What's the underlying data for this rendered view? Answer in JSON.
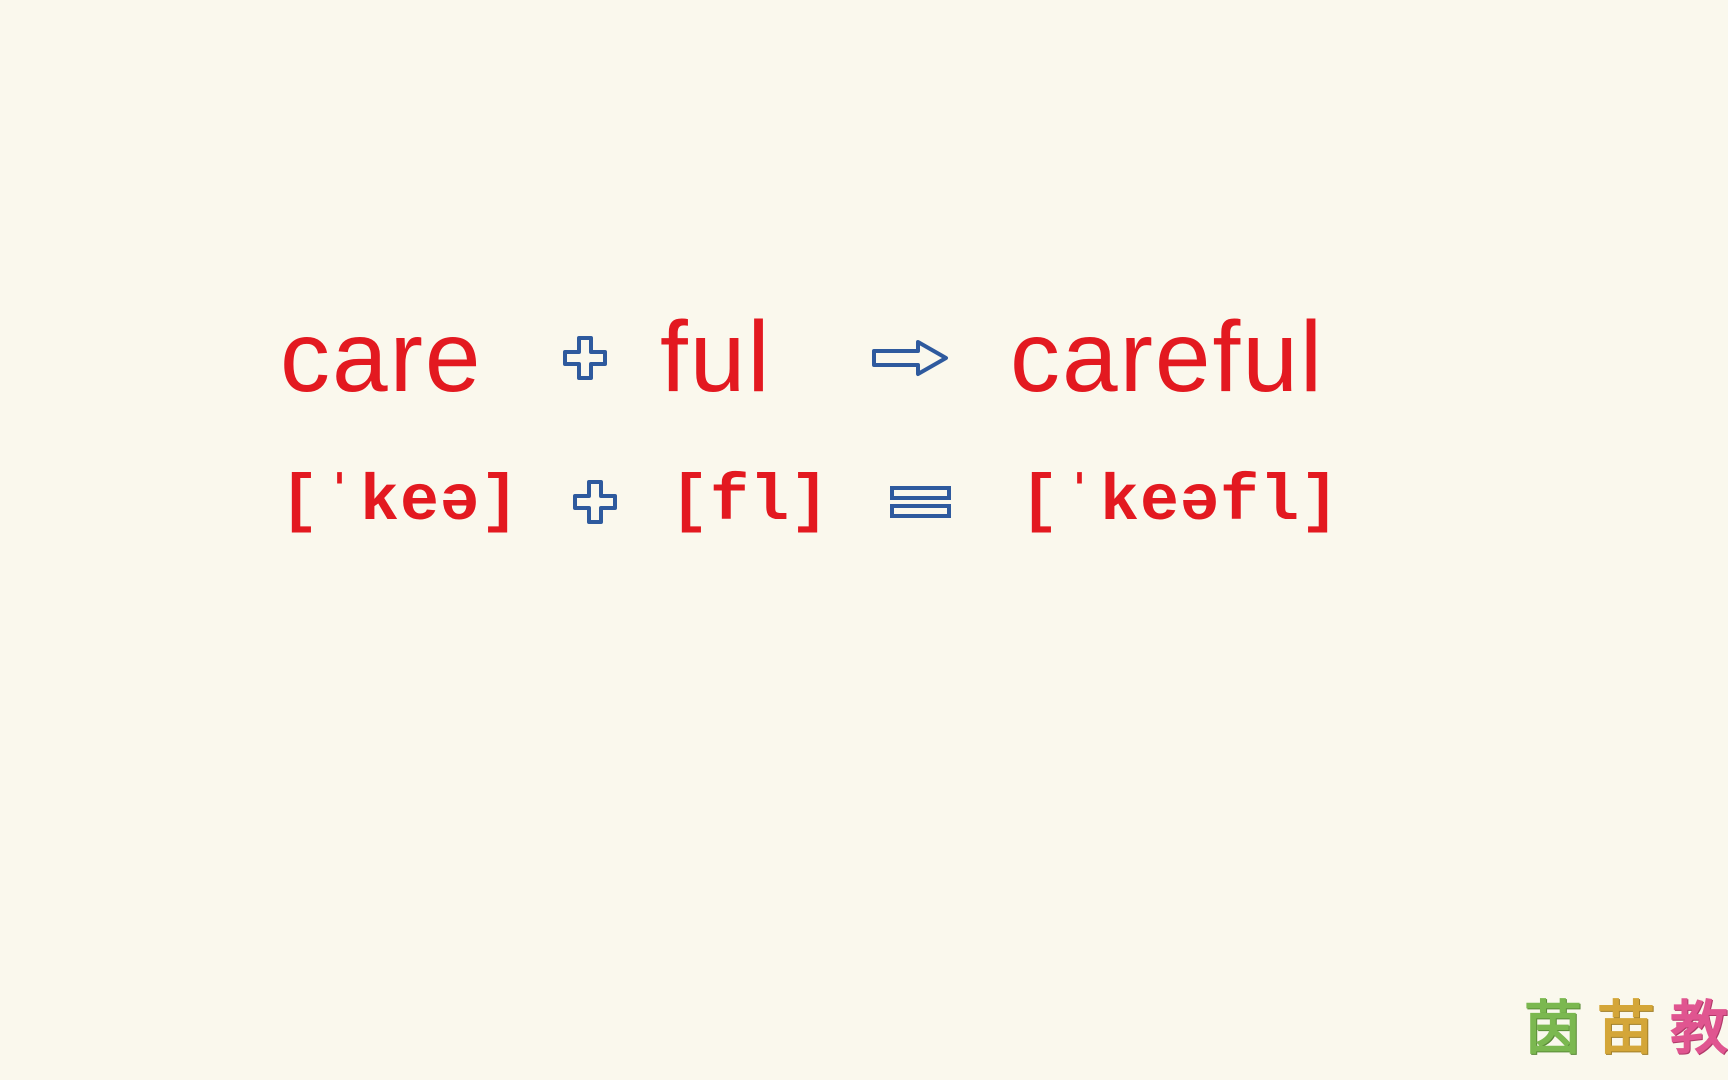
{
  "row1": {
    "part1": "care",
    "part2": "ful",
    "result": "careful"
  },
  "row2": {
    "part1": "[ˈkeə]",
    "part2": "[fl]",
    "result": "[ˈkeəfl]"
  },
  "watermark": {
    "char1": "茵",
    "char2": "苗",
    "char3": "教"
  },
  "symbols": {
    "plus": "plus-outline",
    "arrow": "arrow-right-outline",
    "equals": "equals-outline"
  },
  "colors": {
    "text": "#e31920",
    "symbol": "#2e5a9e",
    "background": "#faf8ed"
  }
}
